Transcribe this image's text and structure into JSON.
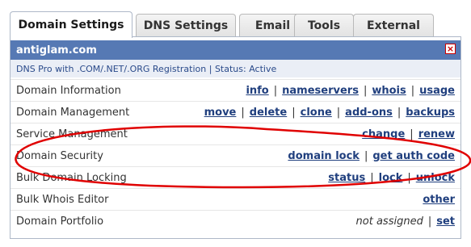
{
  "tabs": [
    {
      "label": "Domain Settings"
    },
    {
      "label": "DNS Settings"
    },
    {
      "label": "Email"
    },
    {
      "label": "Tools"
    },
    {
      "label": "External"
    }
  ],
  "panel": {
    "domain": "antiglam.com",
    "subtitle": "DNS Pro with .COM/.NET/.ORG Registration | Status: Active",
    "close_icon": "close-icon",
    "annotation_color": "#e00000"
  },
  "rows": [
    {
      "label": "Domain Information",
      "links": [
        "info",
        "nameservers",
        "whois",
        "usage"
      ]
    },
    {
      "label": "Domain Management",
      "links": [
        "move",
        "delete",
        "clone",
        "add-ons",
        "backups"
      ]
    },
    {
      "label": "Service Management",
      "links": [
        "change",
        "renew"
      ]
    },
    {
      "label": "Domain Security",
      "links": [
        "domain lock",
        "get auth code"
      ]
    },
    {
      "label": "Bulk Domain Locking",
      "links": [
        "status",
        "lock",
        "unlock"
      ]
    },
    {
      "label": "Bulk Whois Editor",
      "links": [
        "other"
      ]
    },
    {
      "label": "Domain Portfolio",
      "status": "not assigned",
      "links": [
        "set"
      ]
    }
  ]
}
